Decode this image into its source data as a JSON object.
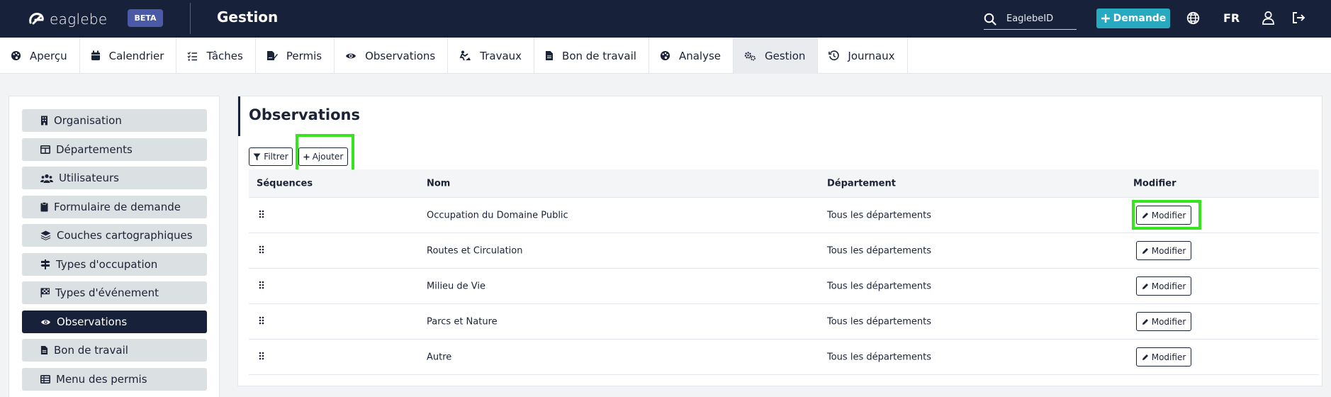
{
  "brand": {
    "name": "eaglebe",
    "badge": "BETA"
  },
  "header": {
    "title": "Gestion",
    "search_placeholder": "EaglebeID",
    "request_button": "Demande",
    "language": "FR"
  },
  "nav": {
    "tabs": [
      {
        "label": "Aperçu",
        "icon": "palette-icon"
      },
      {
        "label": "Calendrier",
        "icon": "calendar-icon"
      },
      {
        "label": "Tâches",
        "icon": "checklist-icon"
      },
      {
        "label": "Permis",
        "icon": "file-signature-icon"
      },
      {
        "label": "Observations",
        "icon": "eye-icon"
      },
      {
        "label": "Travaux",
        "icon": "digging-icon"
      },
      {
        "label": "Bon de travail",
        "icon": "file-icon"
      },
      {
        "label": "Analyse",
        "icon": "palette-icon"
      },
      {
        "label": "Gestion",
        "icon": "gears-icon",
        "active": true
      },
      {
        "label": "Journaux",
        "icon": "history-icon"
      }
    ]
  },
  "sidebar": {
    "items": [
      {
        "label": "Organisation",
        "icon": "building-icon"
      },
      {
        "label": "Départements",
        "icon": "table-icon"
      },
      {
        "label": "Utilisateurs",
        "icon": "users-icon"
      },
      {
        "label": "Formulaire de demande",
        "icon": "clipboard-icon"
      },
      {
        "label": "Couches cartographiques",
        "icon": "layers-icon"
      },
      {
        "label": "Types d'occupation",
        "icon": "signpost-icon"
      },
      {
        "label": "Types d'événement",
        "icon": "flag-checkered-icon"
      },
      {
        "label": "Observations",
        "icon": "eye-icon",
        "active": true
      },
      {
        "label": "Bon de travail",
        "icon": "file-icon"
      },
      {
        "label": "Menu des permis",
        "icon": "table-list-icon"
      }
    ]
  },
  "main": {
    "title": "Observations",
    "filter_button": "Filtrer",
    "add_button": "Ajouter",
    "table": {
      "headers": [
        "Séquences",
        "Nom",
        "Département",
        "Modifier"
      ],
      "rows": [
        {
          "name": "Occupation du Domaine Public",
          "department": "Tous les départements",
          "action": "Modifier"
        },
        {
          "name": "Routes et Circulation",
          "department": "Tous les départements",
          "action": "Modifier"
        },
        {
          "name": "Milieu de Vie",
          "department": "Tous les départements",
          "action": "Modifier"
        },
        {
          "name": "Parcs et Nature",
          "department": "Tous les départements",
          "action": "Modifier"
        },
        {
          "name": "Autre",
          "department": "Tous les départements",
          "action": "Modifier"
        }
      ]
    }
  },
  "colors": {
    "header_bg": "#18213a",
    "accent": "#27a9bf",
    "highlight": "#37e51f",
    "beta_badge": "#4b5aa6"
  }
}
